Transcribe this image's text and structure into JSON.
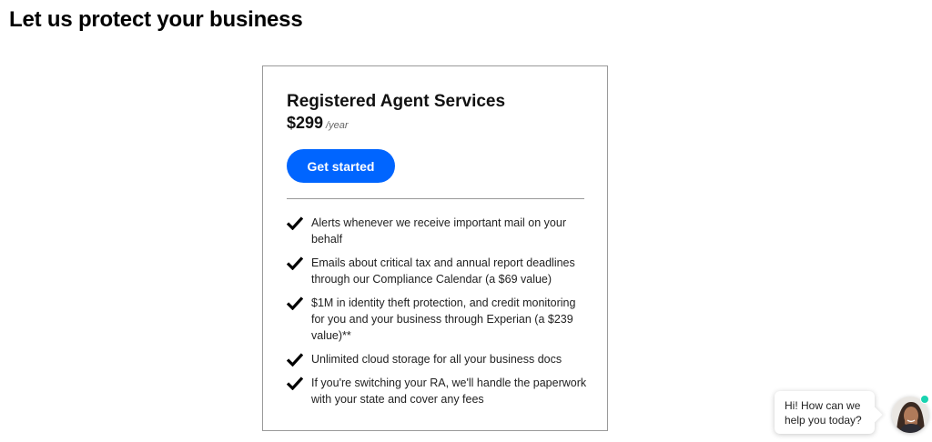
{
  "page": {
    "heading": "Let us protect your business"
  },
  "card": {
    "title": "Registered Agent Services",
    "price": "$299",
    "price_unit": "/year",
    "cta_label": "Get started",
    "features": [
      {
        "text": "Alerts whenever we receive important mail on your behalf",
        "icon": "checkmark-icon"
      },
      {
        "text": "Emails about critical tax and annual report deadlines through our Compliance Calendar (a $69 value)",
        "icon": "checkmark-icon"
      },
      {
        "text": "$1M in identity theft protection, and credit monitoring for you and your business through Experian (a $239 value)**",
        "icon": "checkmark-icon"
      },
      {
        "text": "Unlimited cloud storage for all your business docs",
        "icon": "checkmark-icon"
      },
      {
        "text": "If you're switching your RA, we'll handle the paperwork with your state and cover any fees",
        "icon": "checkmark-icon"
      }
    ]
  },
  "chat": {
    "message": "Hi! How can we help you today?",
    "avatar_icon": "support-agent-avatar",
    "status": "online"
  },
  "colors": {
    "cta": "#0065ff",
    "status_online": "#19d3b0",
    "card_border": "#9a9a9a"
  }
}
